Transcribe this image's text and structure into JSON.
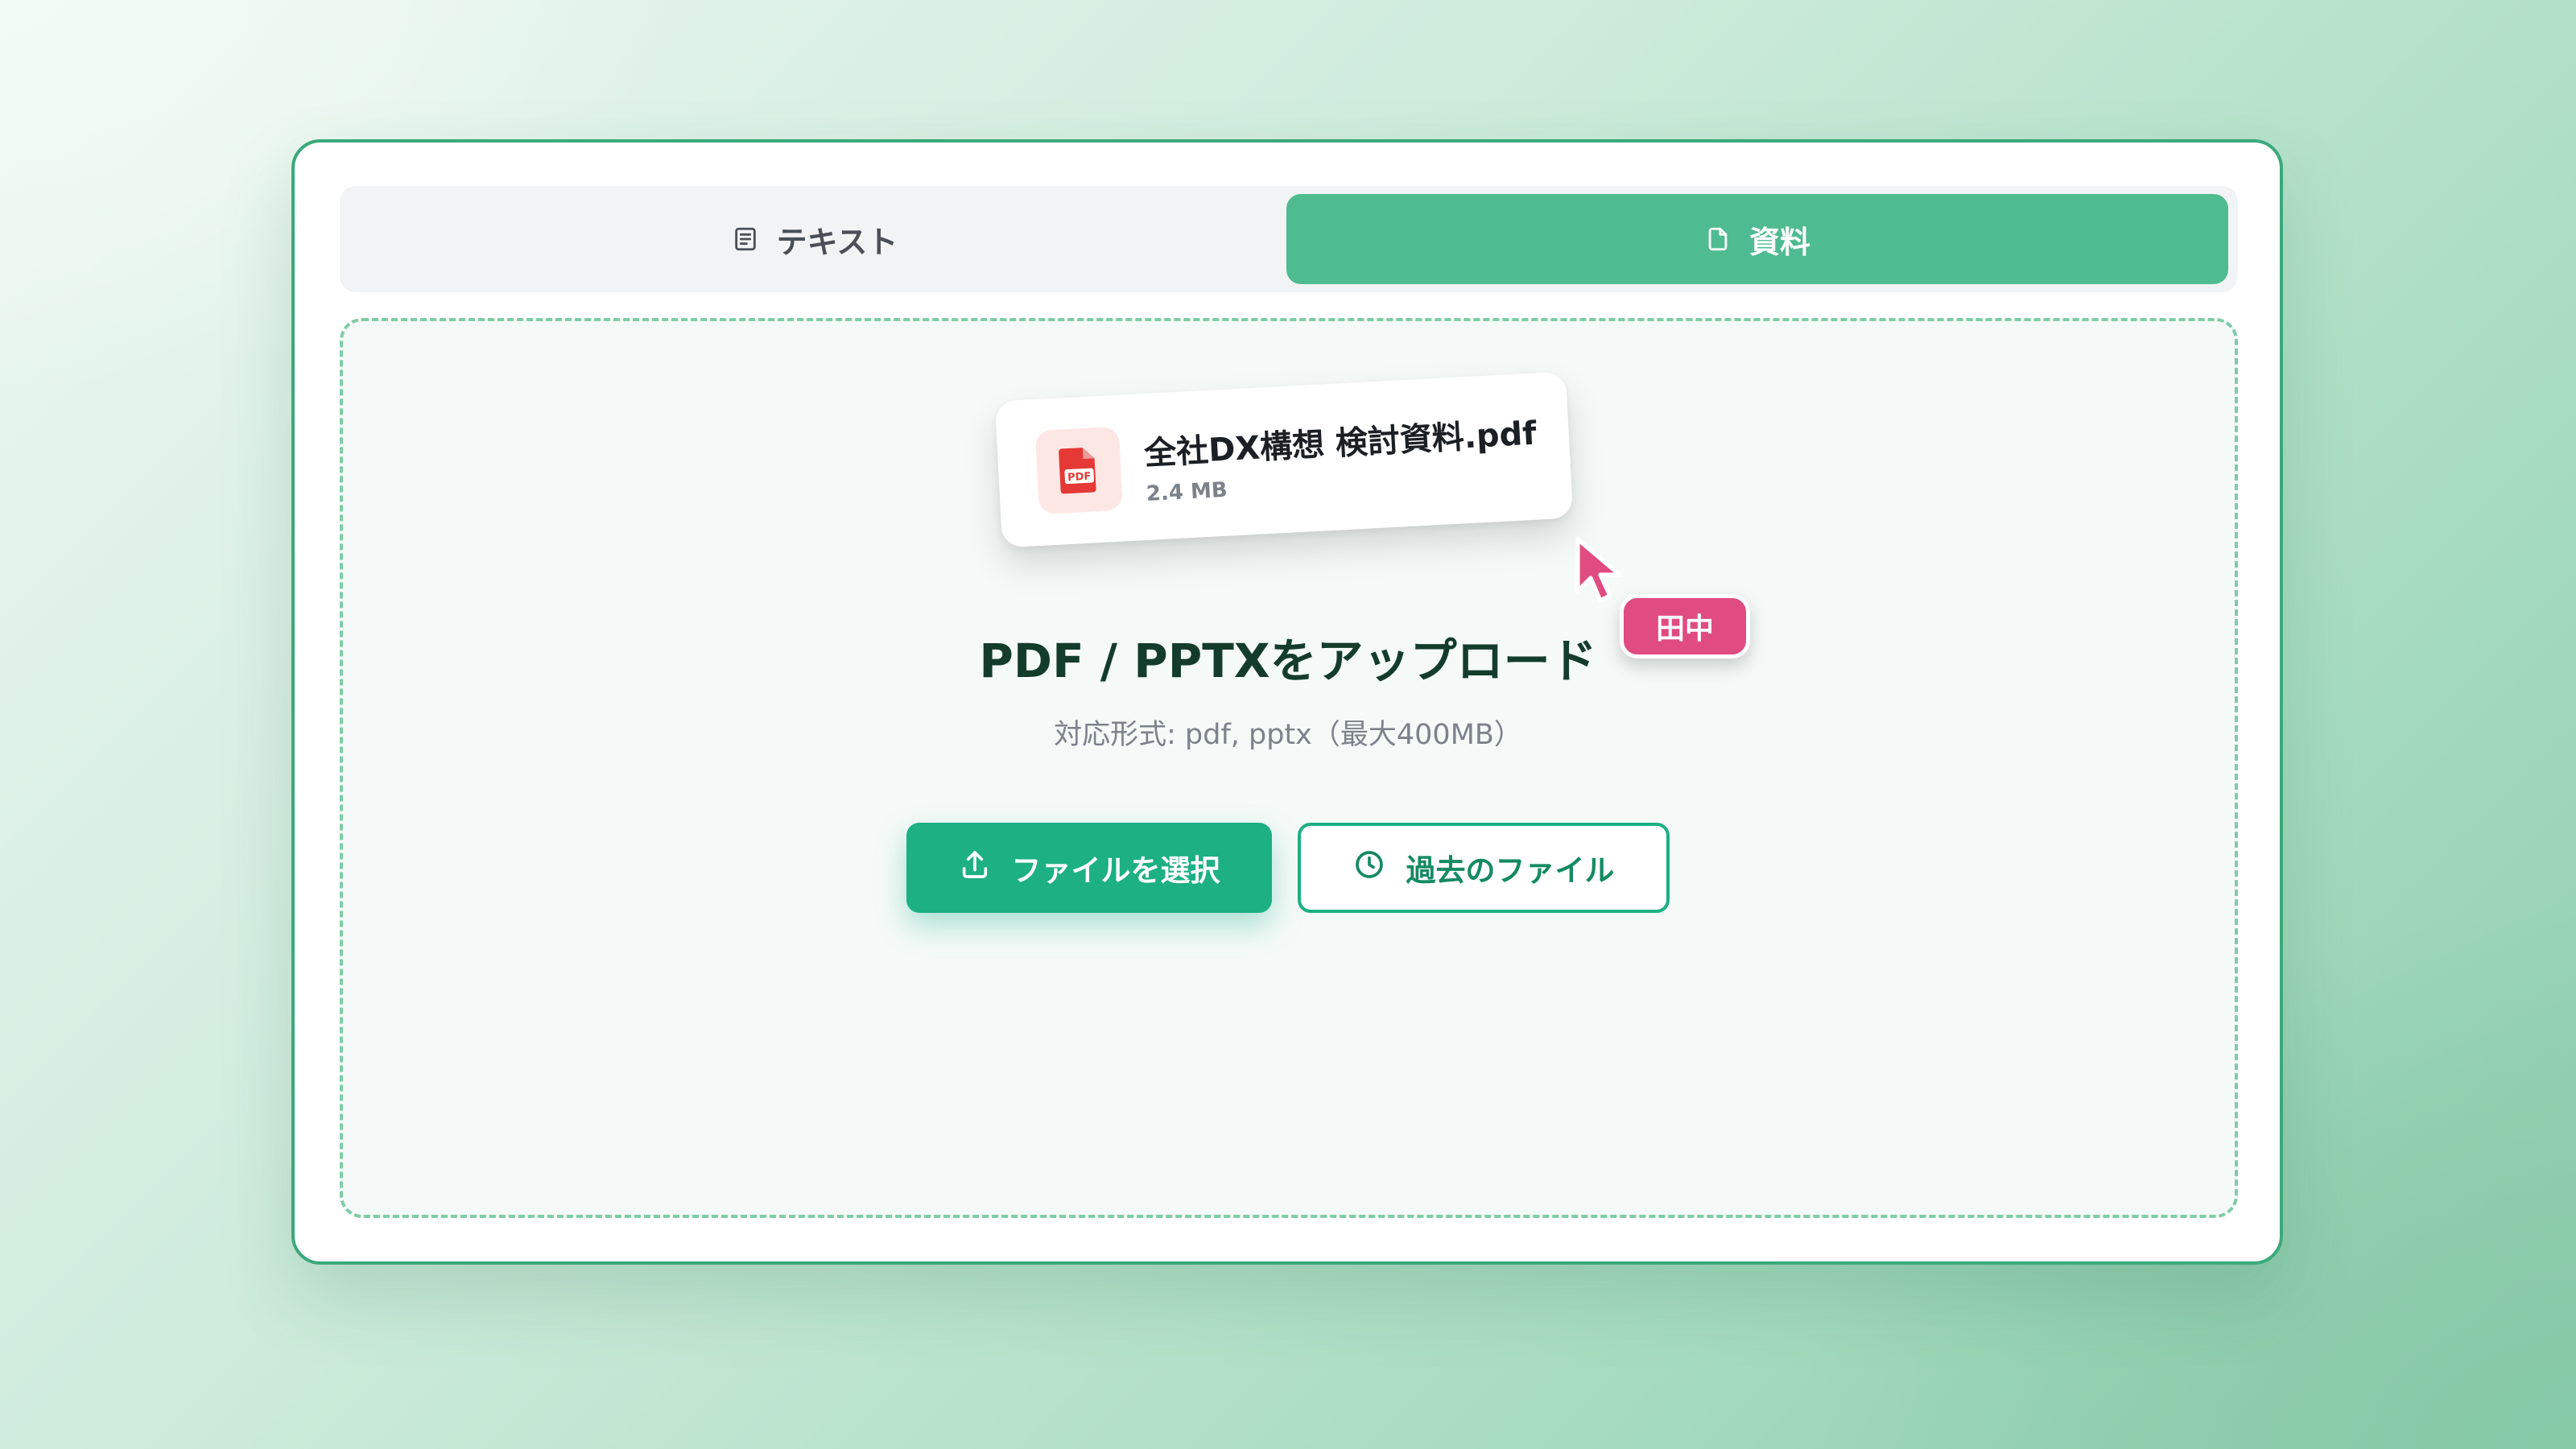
{
  "tabs": [
    {
      "label": "テキスト",
      "icon": "document-lines-icon",
      "active": false
    },
    {
      "label": "資料",
      "icon": "file-icon",
      "active": true
    }
  ],
  "file_card": {
    "name": "全社DX構想 検討資料.pdf",
    "size": "2.4 MB",
    "icon": "pdf-file-icon",
    "icon_label": "PDF"
  },
  "cursor": {
    "user": "田中",
    "color": "#e04b80"
  },
  "upload": {
    "title": "PDF / PPTXをアップロード",
    "formats": "対応形式: pdf, pptx（最大400MB）"
  },
  "buttons": {
    "select_label": "ファイルを選択",
    "history_label": "過去のファイル"
  },
  "colors": {
    "accent": "#1cb083",
    "tab_active": "#4fbb90",
    "border": "#3aa97b",
    "heading": "#133c2c"
  }
}
